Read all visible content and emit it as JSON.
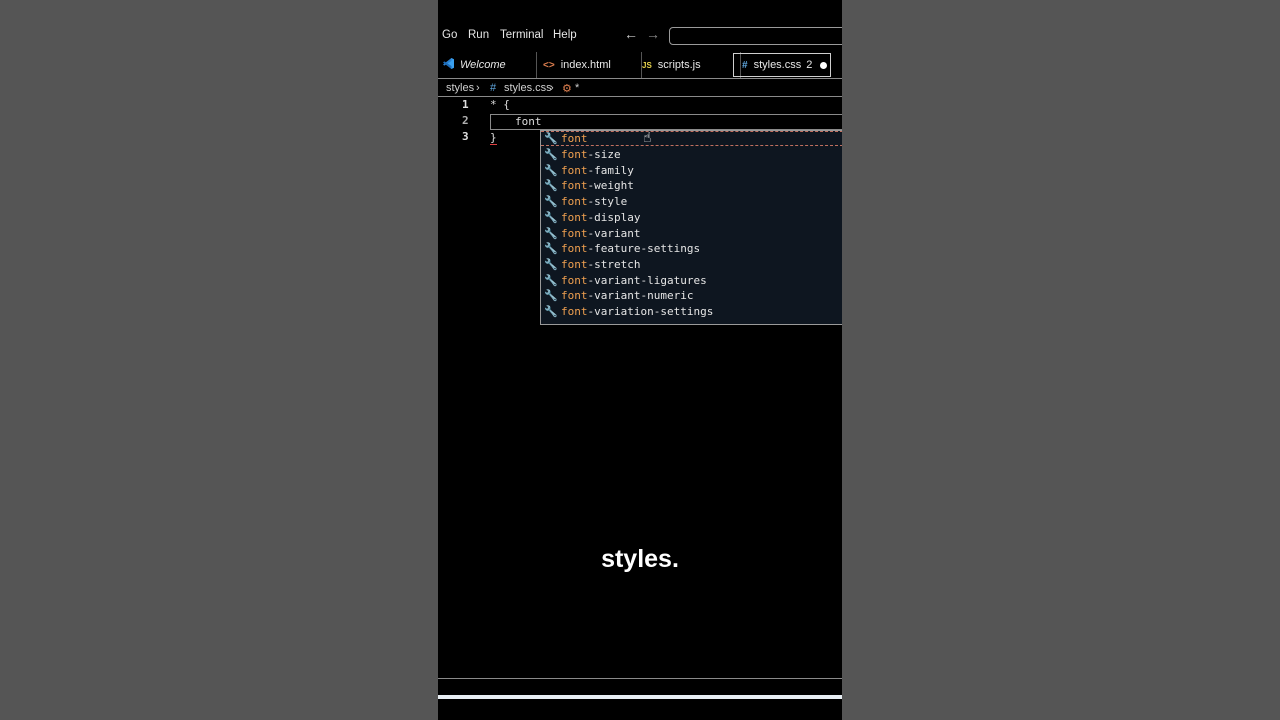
{
  "menu": {
    "items": [
      "Go",
      "Run",
      "Terminal",
      "Help"
    ]
  },
  "nav": {
    "back": "←",
    "forward": "→"
  },
  "tabs": [
    {
      "label": "Welcome",
      "icon": "vscode-icon"
    },
    {
      "label": "index.html",
      "icon": "html-icon",
      "icon_text": "<>"
    },
    {
      "label": "scripts.js",
      "icon": "js-icon",
      "icon_text": "JS"
    },
    {
      "label": "styles.css",
      "icon": "css-icon",
      "icon_text": "#",
      "badge": "2",
      "modified": true
    }
  ],
  "breadcrumb": {
    "folder": "styles",
    "file_icon": "#",
    "file": "styles.css",
    "symbol": "*"
  },
  "editor": {
    "line_numbers": [
      "1",
      "2",
      "3"
    ],
    "line1": "* {",
    "line2": "font",
    "line3": "}"
  },
  "suggestions": {
    "match": "font",
    "items": [
      "-size",
      "-family",
      "-weight",
      "-style",
      "-display",
      "-variant",
      "-feature-settings",
      "-stretch",
      "-variant-ligatures",
      "-variant-numeric",
      "-variation-settings"
    ],
    "first": ""
  },
  "caption": "styles.",
  "colors": {
    "match": "#f0a050",
    "accent": "#3aa0f0"
  }
}
